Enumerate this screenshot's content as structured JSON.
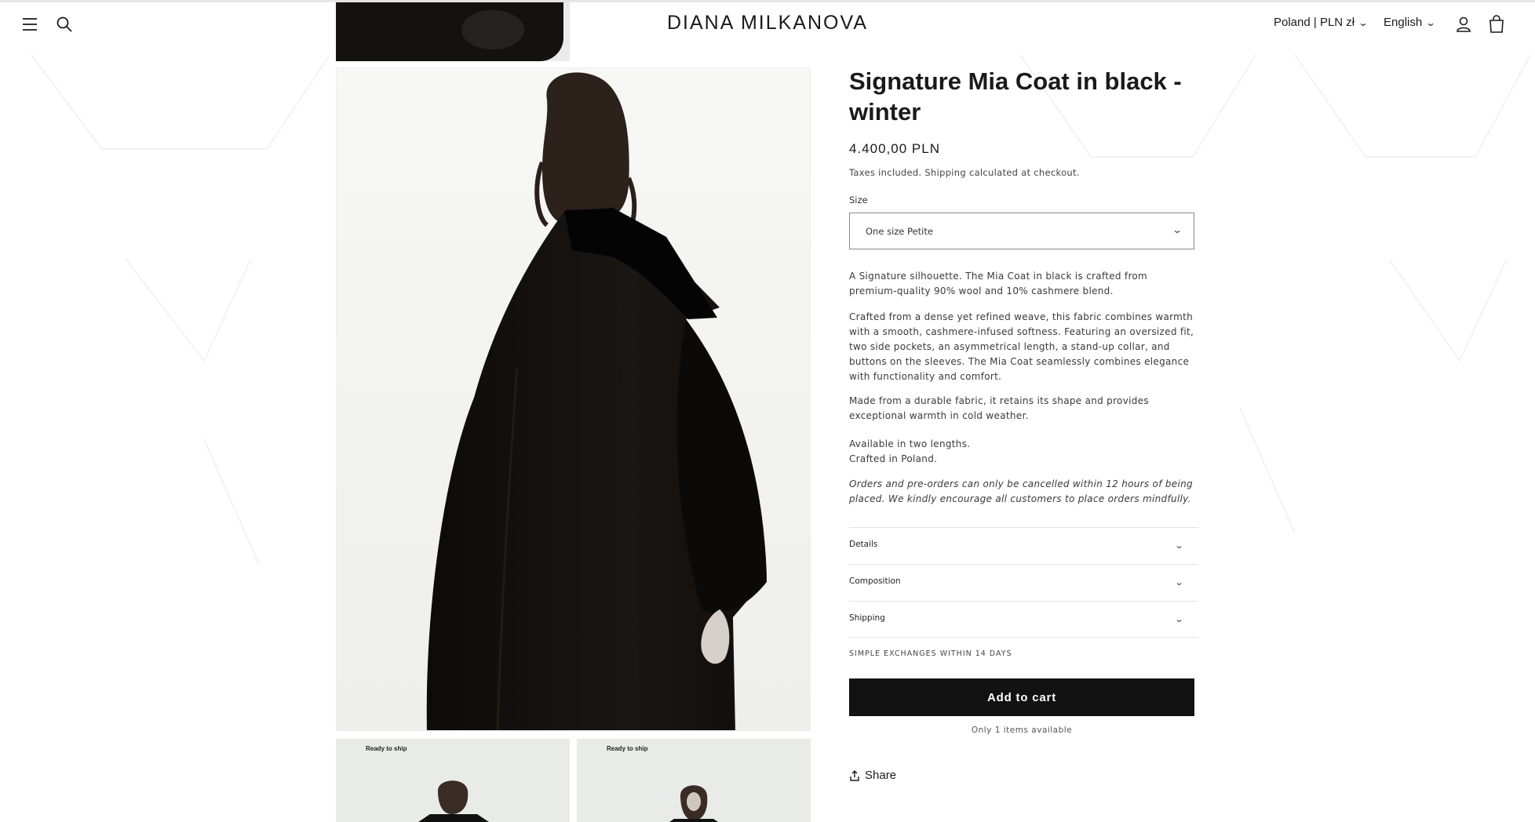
{
  "header": {
    "brand": "DIANA MILKANOVA",
    "country_selector": "Poland | PLN zł",
    "language_selector": "English"
  },
  "gallery": {
    "thumbnail_tag_1": "Ready to ship",
    "thumbnail_tag_2": "Ready to ship"
  },
  "product": {
    "title": "Signature Mia Coat in black - winter",
    "price": "4.400,00 PLN",
    "tax_note": "Taxes included. Shipping calculated at checkout.",
    "size_label": "Size",
    "size_value": "One size Petite",
    "description": [
      " A Signature silhouette. The Mia Coat in black is crafted from premium-quality 90% wool and 10% cashmere blend.",
      "Crafted from a dense yet refined weave, this fabric combines warmth with a smooth, cashmere-infused softness. Featuring an oversized fit, two side pockets, an asymmetrical length, a stand-up collar, and buttons on the sleeves. The Mia Coat seamlessly combines elegance with functionality and comfort.",
      "Made from a durable fabric, it retains its shape and provides exceptional warmth in cold weather.",
      "Available in two lengths.",
      "Crafted in Poland.",
      "Orders and pre-orders can only be cancelled within 12 hours of being placed. We kindly encourage all customers to place orders mindfully."
    ],
    "accordions": [
      "Details",
      "Composition",
      "Shipping"
    ],
    "exchange_note": "SIMPLE EXCHANGES WITHIN 14 DAYS",
    "add_to_cart": "Add to cart",
    "availability": "Only 1 items available",
    "share": "Share"
  },
  "icons": {
    "menu": "menu-icon",
    "search": "search-icon",
    "account": "account-icon",
    "cart": "cart-icon",
    "share": "share-icon",
    "chevron": "chevron-down-icon"
  },
  "colors": {
    "button_bg": "#121212",
    "text": "#1a1a1a",
    "border": "#8a8a8a"
  }
}
